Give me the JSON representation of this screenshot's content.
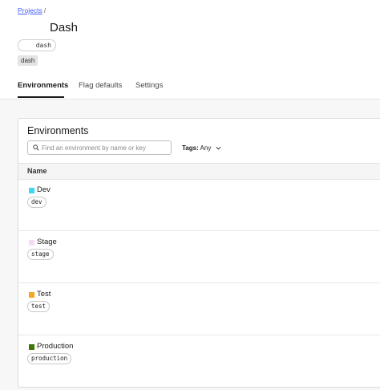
{
  "breadcrumb": {
    "projects_link": "Projects",
    "separator": "/"
  },
  "project": {
    "title": "Dash",
    "key": "dash",
    "tag": "dash"
  },
  "tabs": [
    {
      "label": "Environments",
      "active": true
    },
    {
      "label": "Flag defaults",
      "active": false
    },
    {
      "label": "Settings",
      "active": false
    }
  ],
  "environments_card": {
    "title": "Environments",
    "search_placeholder": "Find an environment by name or key",
    "tags_filter": {
      "label": "Tags:",
      "value": "Any"
    },
    "column_header": "Name",
    "rows": [
      {
        "name": "Dev",
        "key": "dev",
        "color": "#3dd6f5"
      },
      {
        "name": "Stage",
        "key": "stage",
        "color": "#f5dcf5"
      },
      {
        "name": "Test",
        "key": "test",
        "color": "#f5a623"
      },
      {
        "name": "Production",
        "key": "production",
        "color": "#417505"
      }
    ]
  },
  "icons": {
    "search": "search-icon",
    "dropdown": "chevron-down-icon"
  }
}
